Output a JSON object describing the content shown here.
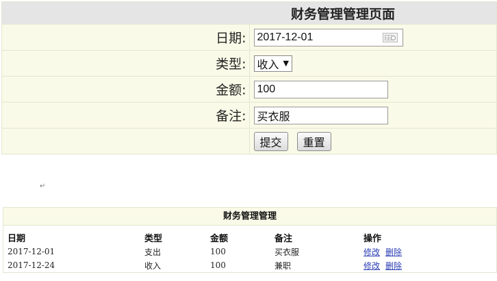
{
  "form": {
    "title": "财务管理管理页面",
    "date_label": "日期:",
    "date_value": "2017-12-01",
    "type_label": "类型:",
    "type_value": "收入",
    "amount_label": "金额:",
    "amount_value": "100",
    "note_label": "备注:",
    "note_value": "买衣服",
    "submit_label": "提交",
    "reset_label": "重置"
  },
  "paragraph_mark": "↵",
  "list": {
    "title": "财务管理管理",
    "headers": [
      "日期",
      "类型",
      "金额",
      "备注",
      "操作"
    ],
    "rows": [
      {
        "date": "2017-12-01",
        "type": "支出",
        "amount": "100",
        "note": "买衣服",
        "edit": "修改",
        "delete": "删除"
      },
      {
        "date": "2017-12-24",
        "type": "收入",
        "amount": "100",
        "note": "兼职",
        "edit": "修改",
        "delete": "删除"
      }
    ]
  },
  "colors": {
    "cell_bg": "#fafae8",
    "title_bg": "#e5e5e5",
    "border": "#e2e6cf",
    "link": "#2a3cb4"
  }
}
